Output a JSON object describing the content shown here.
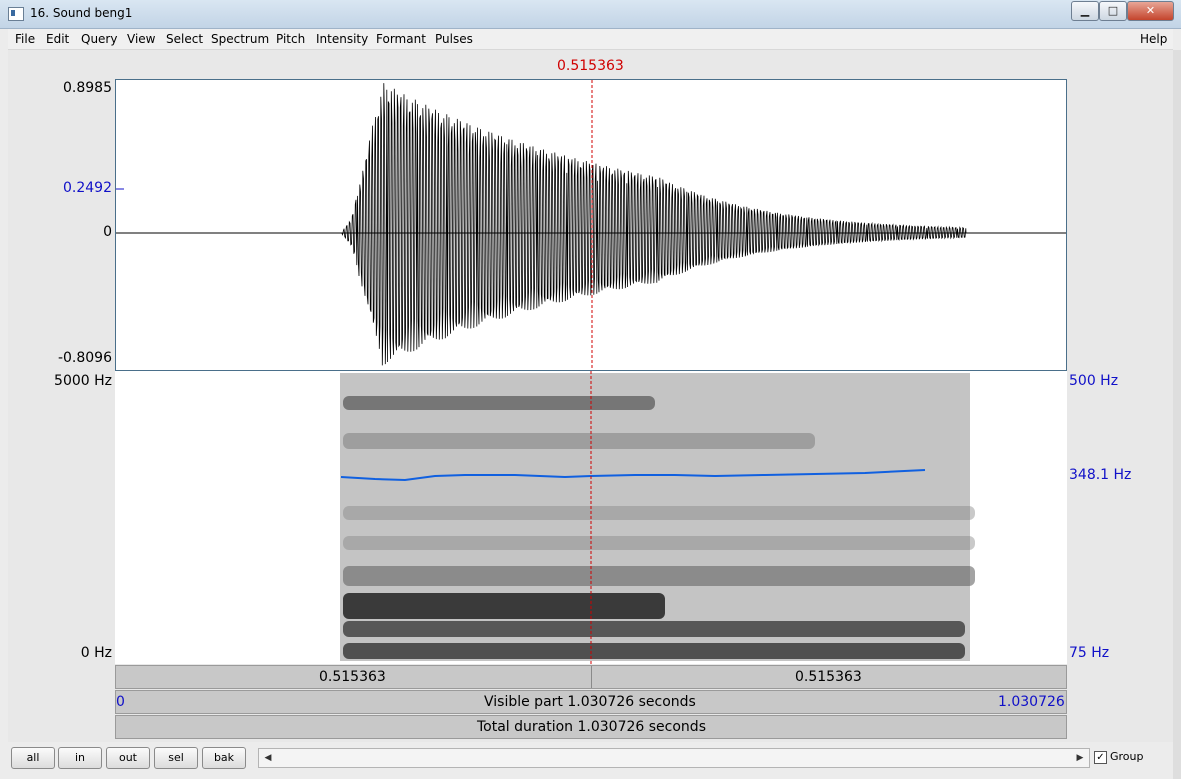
{
  "window": {
    "title": "16. Sound beng1",
    "minimize": "▁",
    "maximize": "□",
    "close": "✕"
  },
  "menu": {
    "items": [
      "File",
      "Edit",
      "Query",
      "View",
      "Select",
      "Spectrum",
      "Pitch",
      "Intensity",
      "Formant",
      "Pulses"
    ],
    "help": "Help"
  },
  "cursor": {
    "time_label": "0.515363"
  },
  "waveform": {
    "ymax": "0.8985",
    "cursor_value": "0.2492",
    "zero": "0",
    "ymin": "-0.8096"
  },
  "spectrogram": {
    "freq_top": "5000 Hz",
    "freq_bottom": "0 Hz",
    "pitch_top": "500 Hz",
    "pitch_current": "348.1 Hz",
    "pitch_bottom": "75 Hz"
  },
  "time_bars": {
    "left_segment": "0.515363",
    "right_segment": "0.515363",
    "visible_start": "0",
    "visible_label": "Visible part 1.030726 seconds",
    "visible_end": "1.030726",
    "total_label": "Total duration 1.030726 seconds"
  },
  "bottom": {
    "buttons": {
      "all": "all",
      "in": "in",
      "out": "out",
      "sel": "sel",
      "bak": "bak"
    },
    "scroll_left": "◀",
    "scroll_right": "▶",
    "group_label": "Group",
    "group_checked": "✓"
  },
  "colors": {
    "cursor": "#d00000",
    "pitch": "#1060e0",
    "labels": "#1010c8"
  }
}
